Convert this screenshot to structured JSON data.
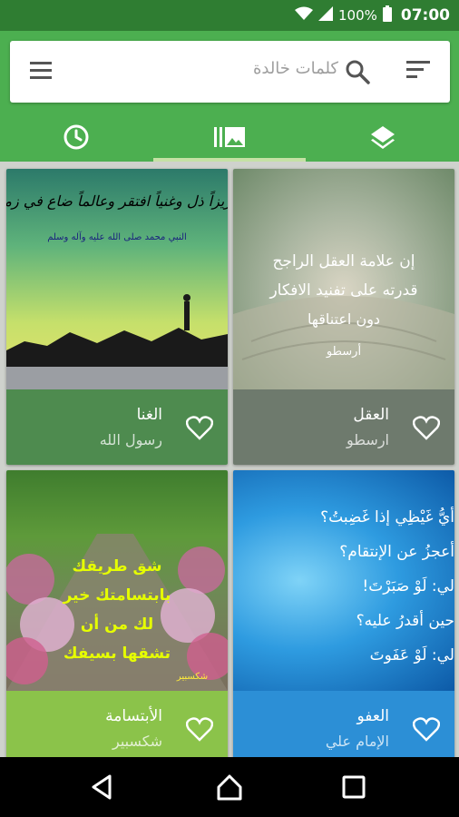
{
  "status_bar": {
    "battery": "100%",
    "time": "07:00"
  },
  "search": {
    "placeholder": "كلمات خالدة"
  },
  "tabs": [
    {
      "name": "recent",
      "icon": "clock-icon"
    },
    {
      "name": "gallery",
      "icon": "gallery-icon",
      "active": true
    },
    {
      "name": "categories",
      "icon": "layers-icon"
    }
  ],
  "cards": [
    {
      "title": "العقل",
      "author": "ارسطو",
      "footer_color": "#6e7a6d",
      "image_lines": [
        "إن علامة العقل الراجح",
        "قدرته على تفنيد الافكار",
        "دون اعتناقها",
        "أرسطو"
      ]
    },
    {
      "title": "الغنا",
      "author": "رسول الله",
      "footer_color": "#4e8b4f",
      "image_lines": [
        "عزيزاً ذل وغنياً افتقر وعالماً ضاع في زمن",
        "النبي محمد صلى الله عليه وآله وسلم"
      ]
    },
    {
      "title": "العفو",
      "author": "الإمام علي",
      "footer_color": "#2c8fd6",
      "image_lines": [
        "أيُّ غَيْظِي إذا غَضِبتُ؟",
        "أعجزُ عن الإنتقام؟",
        "لي: لَوْ صَبَرْتَ!",
        "حين أقدرُ عليه؟",
        "لي: لَوْ عَفَوتَ"
      ]
    },
    {
      "title": "الأبتسامة",
      "author": "شكسبير",
      "footer_color": "#8bc34a",
      "image_lines": [
        "شق طريقك",
        "بابتسامتك خير",
        "لك من أن",
        "تشقها بسيفك",
        "شكسبير"
      ]
    }
  ]
}
